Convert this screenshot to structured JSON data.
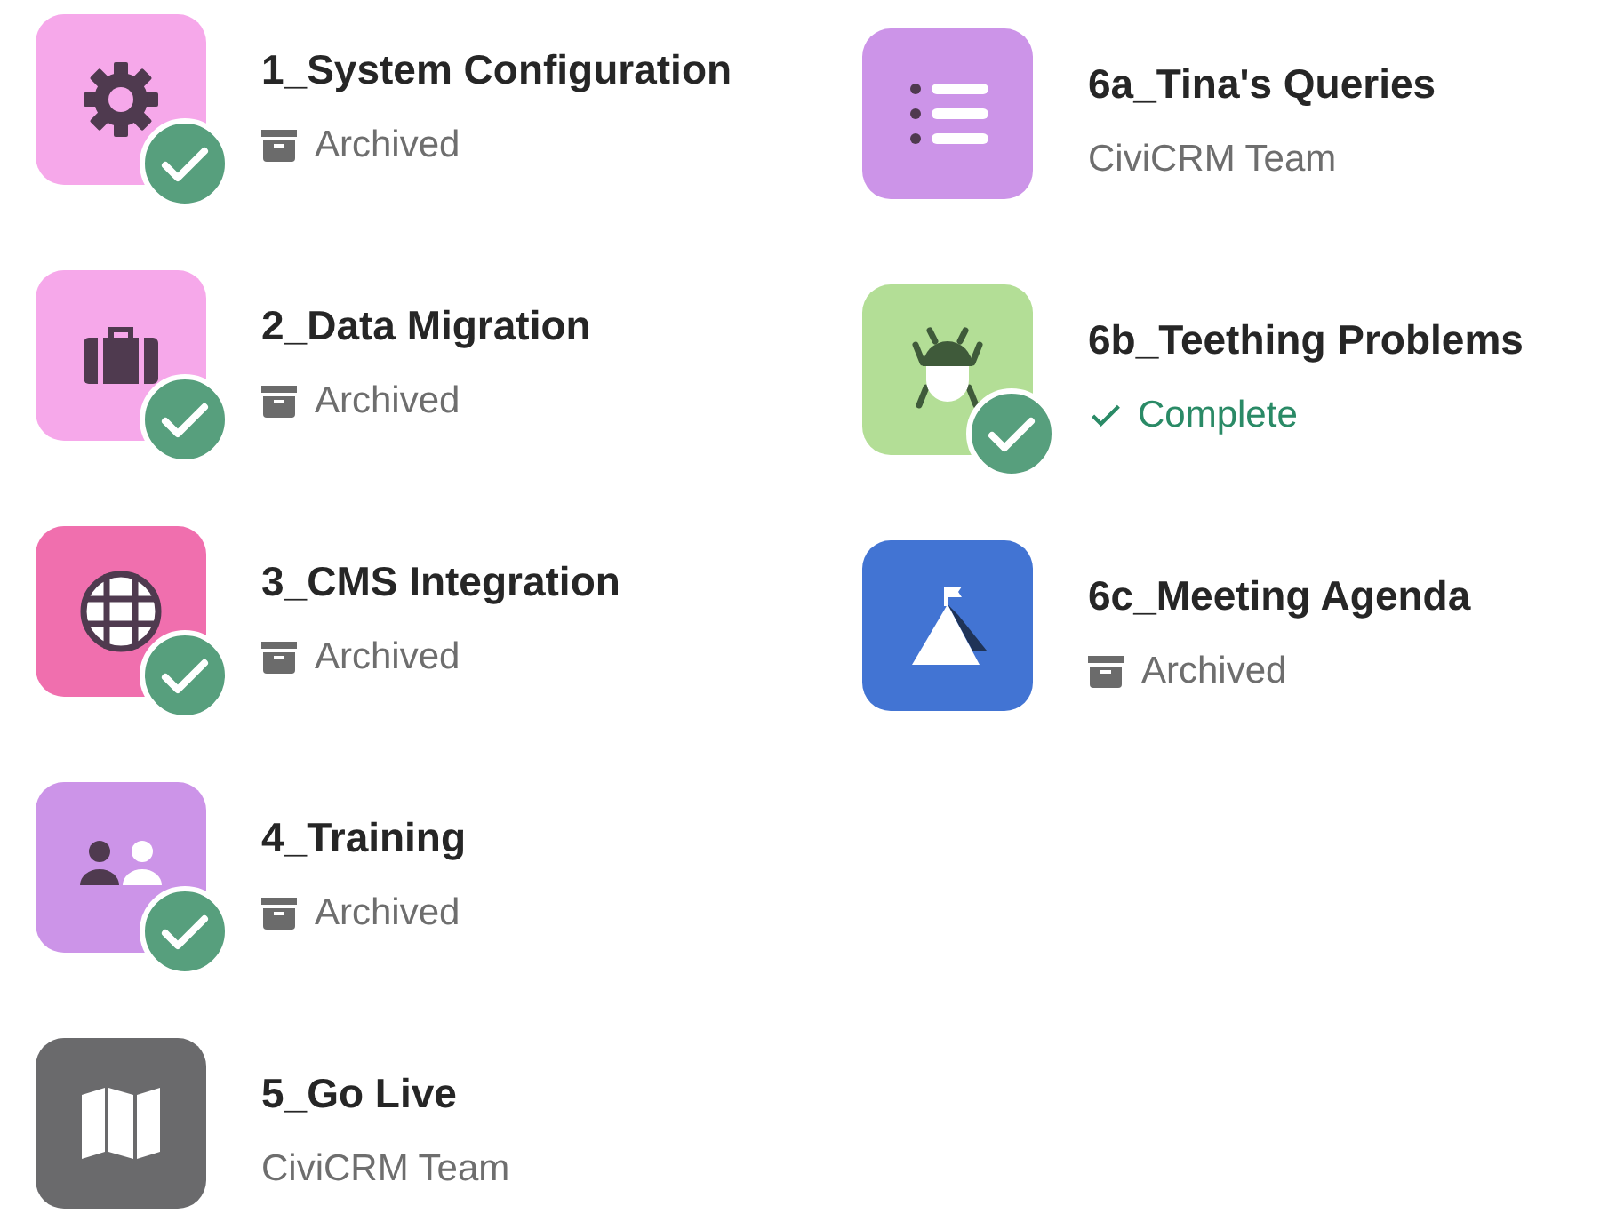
{
  "columns": [
    {
      "projects": [
        {
          "title": "1_System Configuration",
          "kind": "gear",
          "color": "#f6a8ea",
          "completed": true,
          "status": {
            "kind": "archived",
            "text": "Archived"
          }
        },
        {
          "title": "2_Data Migration",
          "kind": "briefcase",
          "color": "#f6a8ea",
          "completed": true,
          "status": {
            "kind": "archived",
            "text": "Archived"
          }
        },
        {
          "title": "3_CMS Integration",
          "kind": "globe",
          "color": "#f06fae",
          "completed": true,
          "status": {
            "kind": "archived",
            "text": "Archived"
          }
        },
        {
          "title": "4_Training",
          "kind": "users",
          "color": "#cc94e8",
          "completed": true,
          "status": {
            "kind": "archived",
            "text": "Archived"
          }
        },
        {
          "title": "5_Go Live",
          "kind": "map",
          "color": "#6a6a6c",
          "completed": false,
          "status": {
            "kind": "team",
            "text": "CiviCRM Team"
          }
        }
      ]
    },
    {
      "projects": [
        {
          "title": "6a_Tina's Queries",
          "kind": "list",
          "color": "#cc94e8",
          "completed": false,
          "status": {
            "kind": "team",
            "text": "CiviCRM Team"
          }
        },
        {
          "title": "6b_Teething Problems",
          "kind": "bug",
          "color": "#b3de96",
          "completed": true,
          "status": {
            "kind": "complete",
            "text": "Complete"
          }
        },
        {
          "title": "6c_Meeting Agenda",
          "kind": "mountain",
          "color": "#4274d3",
          "completed": false,
          "status": {
            "kind": "archived",
            "text": "Archived"
          }
        }
      ]
    }
  ]
}
